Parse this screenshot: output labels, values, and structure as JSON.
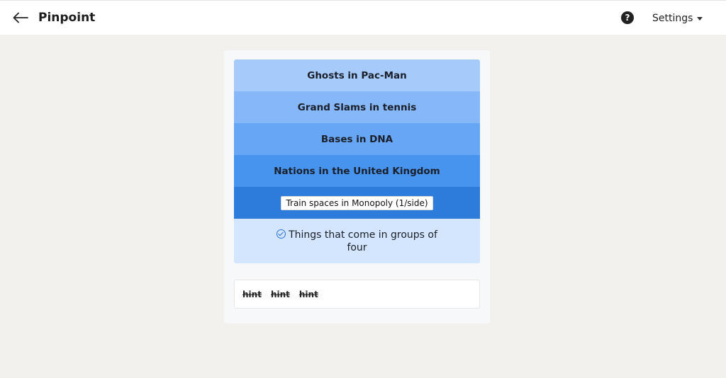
{
  "header": {
    "title": "Pinpoint",
    "help_glyph": "?",
    "settings_label": "Settings"
  },
  "puzzle": {
    "clues": [
      {
        "label": "Ghosts in Pac-Man",
        "color": "#a6cbfb"
      },
      {
        "label": "Grand Slams in tennis",
        "color": "#86b7f8"
      },
      {
        "label": "Bases in DNA",
        "color": "#67a5f5"
      },
      {
        "label": "Nations in the United Kingdom",
        "color": "#4794ef"
      },
      {
        "label": "Train spaces in Monopoly (1/side)",
        "color": "#2d7bdb"
      }
    ],
    "answer": "Things that come in groups of four",
    "hints": [
      "hint",
      "hint",
      "hint"
    ]
  },
  "icons": {
    "back": "arrow-left-icon",
    "help": "question-circle-icon",
    "settings_caret": "caret-down-icon",
    "answer_check": "check-circle-icon"
  }
}
